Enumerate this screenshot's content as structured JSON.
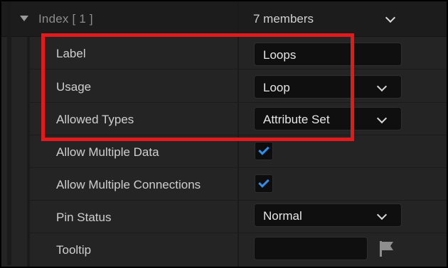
{
  "header": {
    "label": "Index [ 1 ]",
    "value": "7 members"
  },
  "rows": [
    {
      "label": "Label",
      "control": "text",
      "value": "Loops"
    },
    {
      "label": "Usage",
      "control": "dropdown",
      "value": "Loop"
    },
    {
      "label": "Allowed Types",
      "control": "dropdown",
      "value": "Attribute Set"
    },
    {
      "label": "Allow Multiple Data",
      "control": "checkbox",
      "checked": true
    },
    {
      "label": "Allow Multiple Connections",
      "control": "checkbox",
      "checked": true
    },
    {
      "label": "Pin Status",
      "control": "dropdown",
      "value": "Normal"
    },
    {
      "label": "Tooltip",
      "control": "text",
      "value": ""
    }
  ],
  "icons": {
    "expander": "caret-down-icon",
    "dropdown": "chevron-down-icon",
    "check": "checkmark-icon",
    "tooltip_flag": "flag-icon"
  },
  "colors": {
    "highlight": "#e3191c",
    "checkmark": "#2f8fe8"
  }
}
